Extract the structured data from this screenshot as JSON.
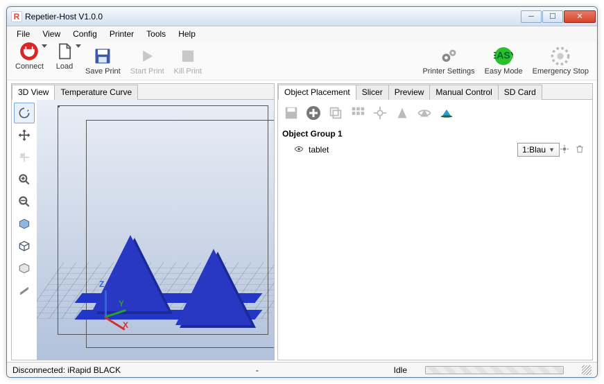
{
  "window": {
    "title": "Repetier-Host V1.0.0",
    "icon_letter": "R"
  },
  "menu": [
    "File",
    "View",
    "Config",
    "Printer",
    "Tools",
    "Help"
  ],
  "toolbar_left": [
    {
      "key": "connect",
      "label": "Connect",
      "enabled": true
    },
    {
      "key": "load",
      "label": "Load",
      "enabled": true
    },
    {
      "key": "saveprint",
      "label": "Save Print",
      "enabled": true
    },
    {
      "key": "startprint",
      "label": "Start Print",
      "enabled": false
    },
    {
      "key": "killprint",
      "label": "Kill Print",
      "enabled": false
    }
  ],
  "toolbar_right": [
    {
      "key": "printersettings",
      "label": "Printer Settings"
    },
    {
      "key": "easymode",
      "label": "Easy Mode"
    },
    {
      "key": "emergency",
      "label": "Emergency Stop"
    }
  ],
  "left_tabs": [
    "3D View",
    "Temperature Curve"
  ],
  "left_active": 0,
  "right_tabs": [
    "Object Placement",
    "Slicer",
    "Preview",
    "Manual Control",
    "SD Card"
  ],
  "right_active": 0,
  "object_group": {
    "title": "Object Group 1",
    "items": [
      {
        "name": "tablet",
        "extruder": "1:Blau"
      }
    ]
  },
  "axis_labels": {
    "x": "X",
    "y": "Y",
    "z": "Z"
  },
  "status": {
    "connection": "Disconnected: iRapid BLACK",
    "center": "-",
    "state": "Idle"
  }
}
